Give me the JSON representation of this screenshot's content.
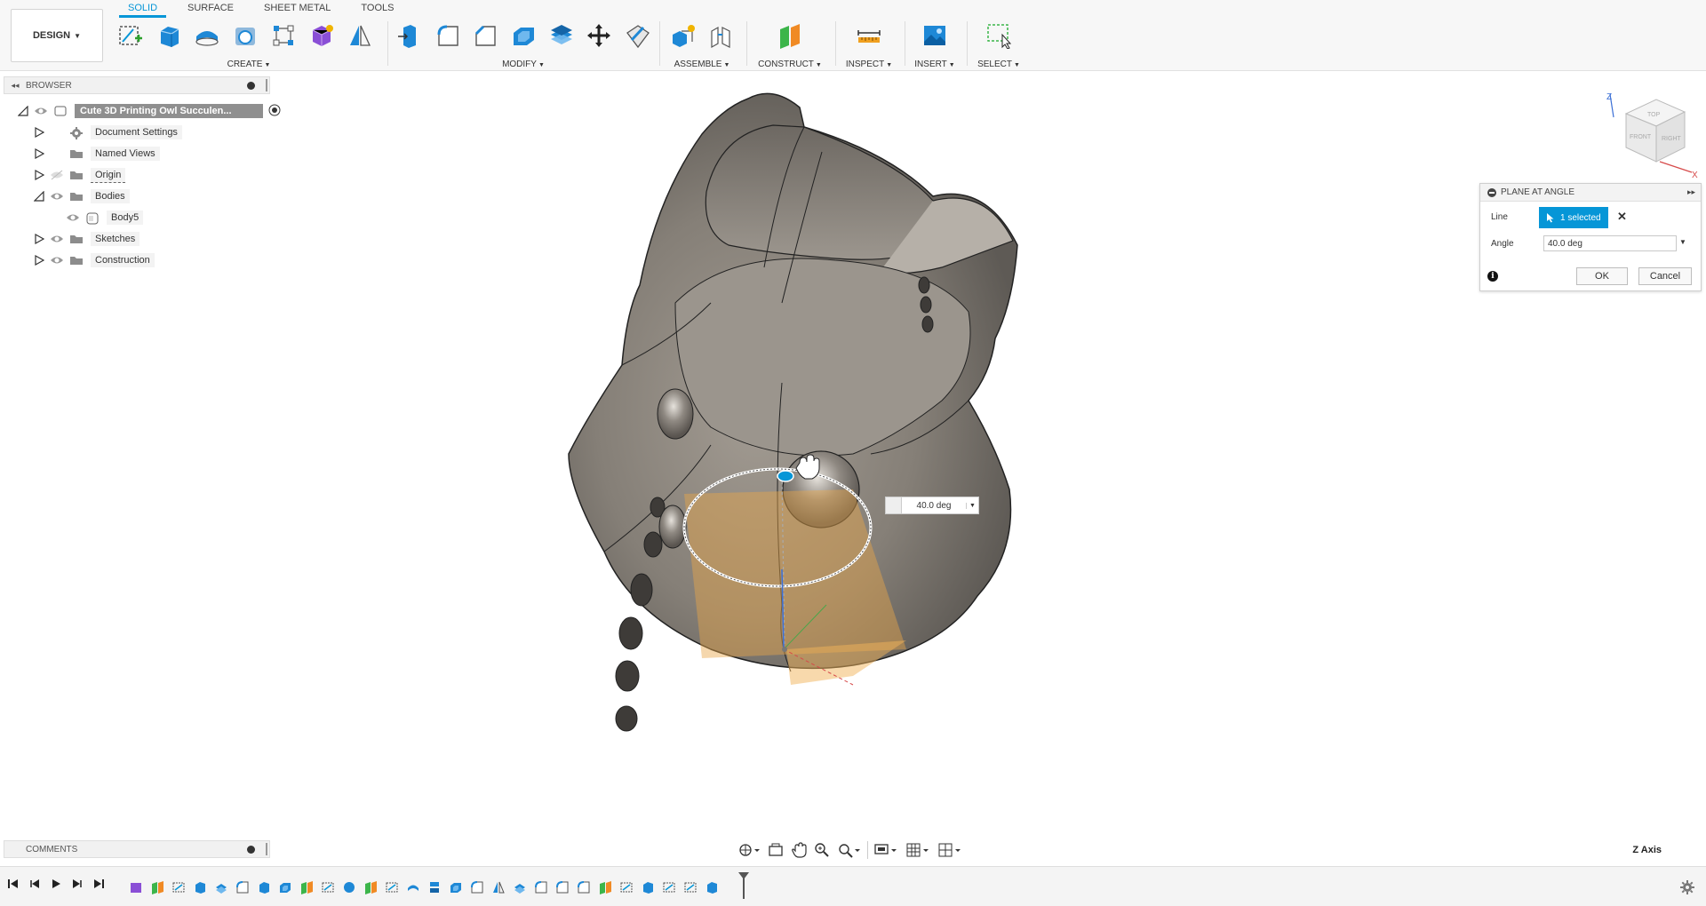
{
  "toolbar": {
    "workspace": "DESIGN",
    "tabs": [
      {
        "label": "SOLID",
        "active": true
      },
      {
        "label": "SURFACE",
        "active": false
      },
      {
        "label": "SHEET METAL",
        "active": false
      },
      {
        "label": "TOOLS",
        "active": false
      }
    ],
    "groups": {
      "create": "CREATE",
      "modify": "MODIFY",
      "assemble": "ASSEMBLE",
      "construct": "CONSTRUCT",
      "inspect": "INSPECT",
      "insert": "INSERT",
      "select": "SELECT"
    },
    "accent": "#0696d7"
  },
  "browser": {
    "title": "BROWSER",
    "root": "Cute 3D Printing Owl Succulen...",
    "items": [
      {
        "label": "Document Settings"
      },
      {
        "label": "Named Views"
      },
      {
        "label": "Origin"
      },
      {
        "label": "Bodies"
      },
      {
        "label": "Body5"
      },
      {
        "label": "Sketches"
      },
      {
        "label": "Construction"
      }
    ]
  },
  "dialog": {
    "title": "PLANE AT ANGLE",
    "line_label": "Line",
    "selection": "1 selected",
    "angle_label": "Angle",
    "angle_value": "40.0 deg",
    "ok": "OK",
    "cancel": "Cancel"
  },
  "viewport": {
    "angle_readout": "40.0 deg",
    "axis": "Z Axis"
  },
  "viewcube": {
    "top": "TOP",
    "front": "FRONT",
    "right": "RIGHT",
    "axis_z": "Z",
    "axis_x": "X"
  },
  "comments": {
    "title": "COMMENTS"
  }
}
